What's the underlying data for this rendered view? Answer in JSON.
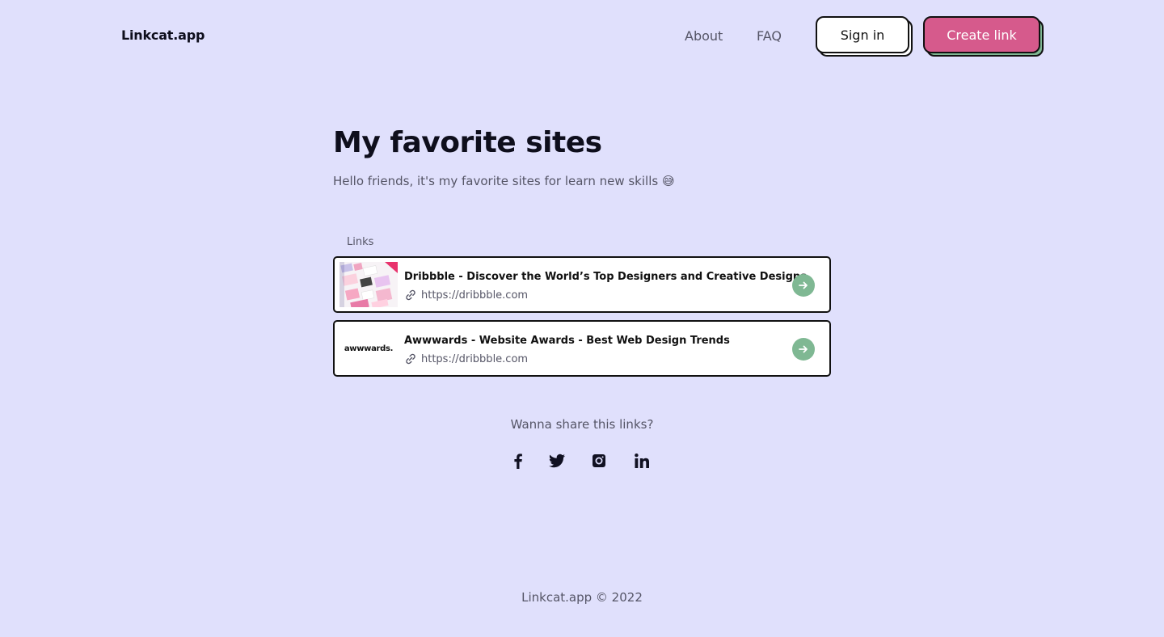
{
  "header": {
    "logo": "Linkcat.app",
    "nav": [
      {
        "label": "About"
      },
      {
        "label": "FAQ"
      }
    ],
    "signin_label": "Sign in",
    "create_label": "Create link"
  },
  "main": {
    "title": "My favorite sites",
    "subtitle": "Hello friends, it's my favorite sites for learn new skills 😅",
    "links_label": "Links",
    "links": [
      {
        "title": "Dribbble - Discover the World’s Top Designers and Creative Designs",
        "url": "https://dribbble.com",
        "thumbnail": "dribbble-screenshot"
      },
      {
        "title": "Awwwards - Website Awards - Best Web Design Trends",
        "url": "https://dribbble.com",
        "thumbnail_text": "awwwards."
      }
    ]
  },
  "share": {
    "heading": "Wanna share this links?",
    "networks": [
      "facebook-icon",
      "twitter-icon",
      "instagram-icon",
      "linkedin-icon"
    ]
  },
  "footer": {
    "text": "Linkcat.app © 2022"
  },
  "colors": {
    "background": "#e0e0fc",
    "accent_pink": "#d65a8c",
    "accent_green": "#7fb893",
    "text_dark": "#0e0e1c",
    "text_muted": "#555566"
  }
}
